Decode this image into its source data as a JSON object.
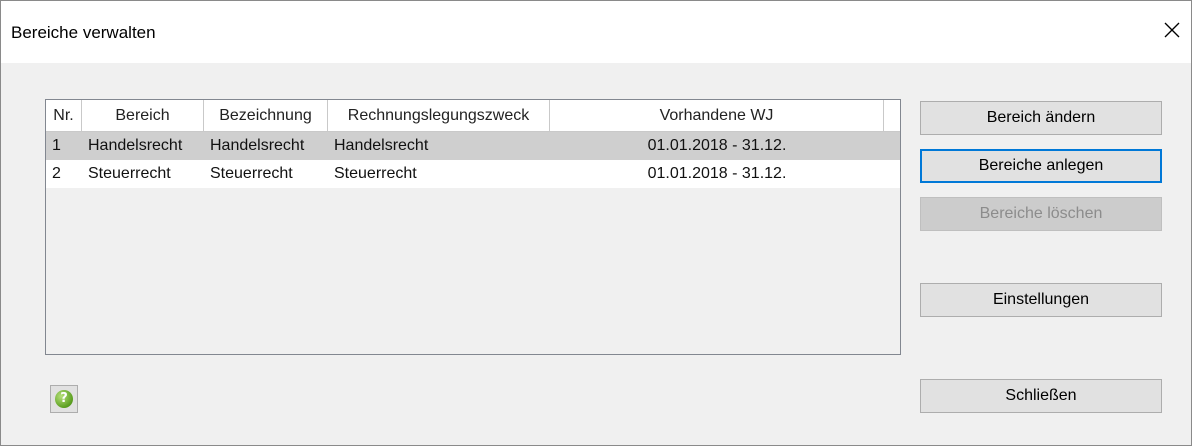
{
  "window": {
    "title": "Bereiche verwalten"
  },
  "table": {
    "columns": [
      "Nr.",
      "Bereich",
      "Bezeichnung",
      "Rechnungslegungszweck",
      "Vorhandene WJ"
    ],
    "rows": [
      {
        "nr": "1",
        "bereich": "Handelsrecht",
        "bezeichnung": "Handelsrecht",
        "zweck": "Handelsrecht",
        "wj": "01.01.2018 - 31.12.",
        "selected": true
      },
      {
        "nr": "2",
        "bereich": "Steuerrecht",
        "bezeichnung": "Steuerrecht",
        "zweck": "Steuerrecht",
        "wj": "01.01.2018 - 31.12.",
        "selected": false
      }
    ]
  },
  "buttons": {
    "edit": "Bereich ändern",
    "create": "Bereiche anlegen",
    "delete": "Bereiche löschen",
    "settings": "Einstellungen",
    "close": "Schließen"
  },
  "help": {
    "glyph": "?",
    "icon": "help-icon",
    "color": "#5a9e1f"
  },
  "colors": {
    "focus_border": "#0078d7",
    "selected_row": "#cfcfcf",
    "dialog_bg": "#f0f0f0"
  }
}
